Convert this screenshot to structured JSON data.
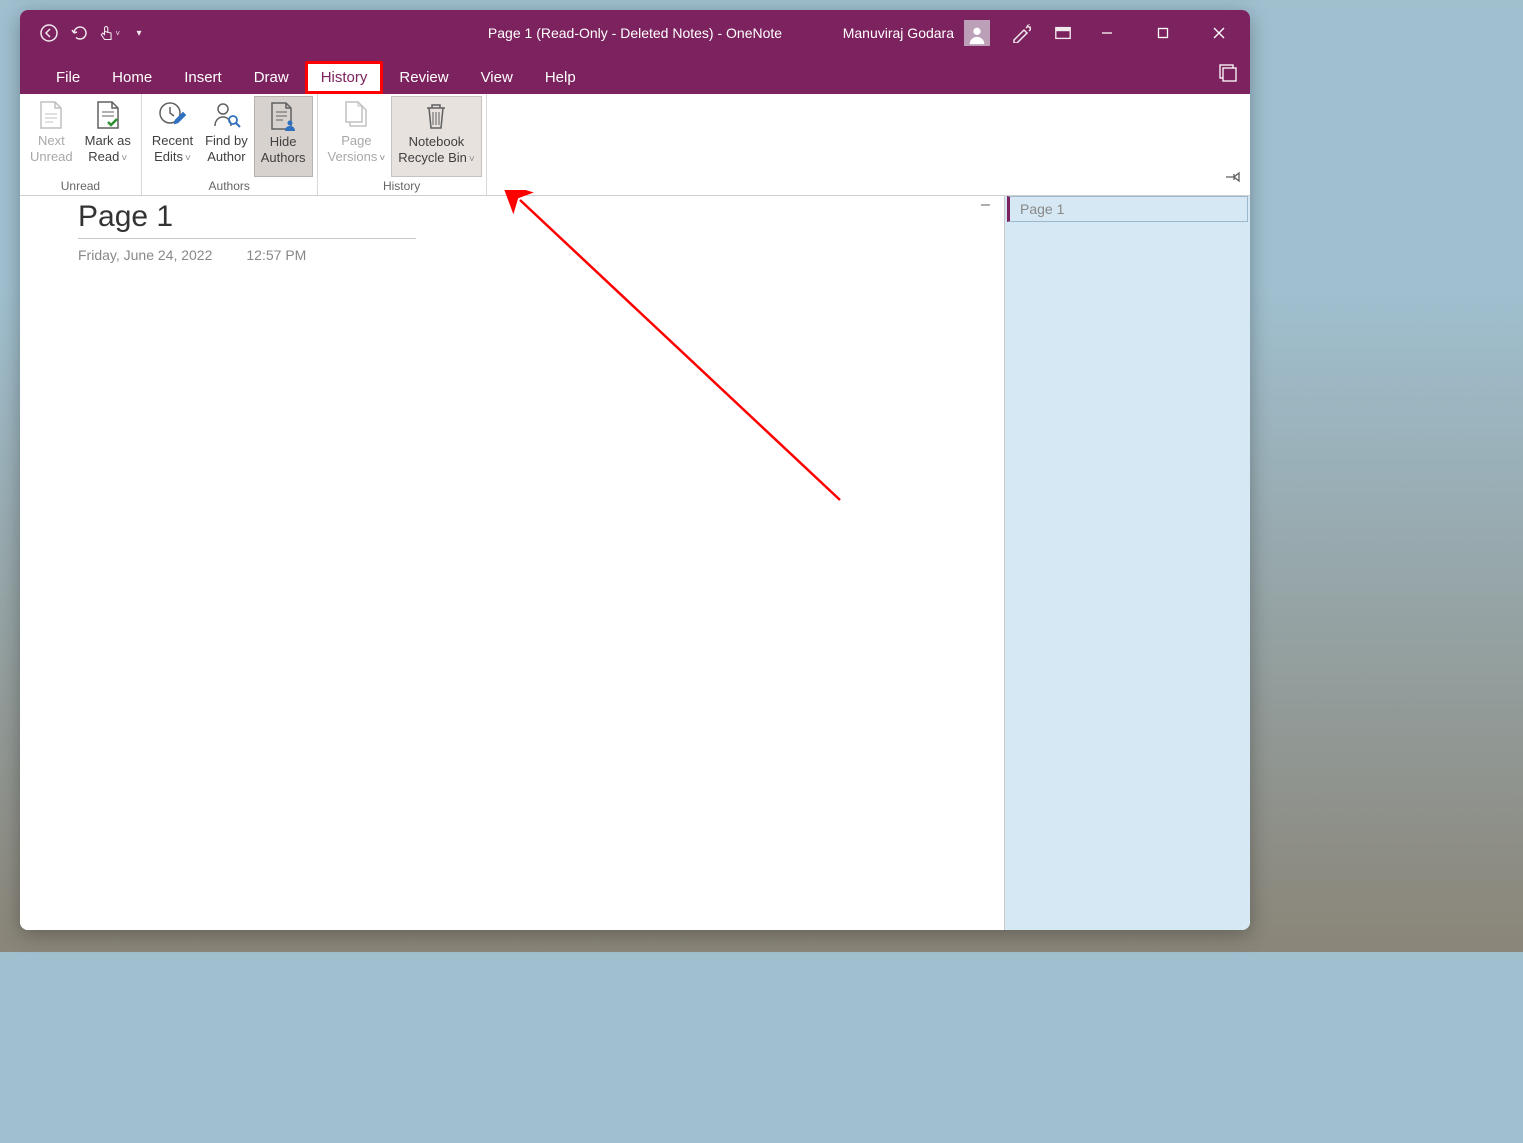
{
  "titlebar": {
    "title": "Page 1 (Read-Only - Deleted Notes)  -  OneNote",
    "user": "Manuviraj Godara"
  },
  "tabs": {
    "file": "File",
    "home": "Home",
    "insert": "Insert",
    "draw": "Draw",
    "history": "History",
    "review": "Review",
    "view": "View",
    "help": "Help"
  },
  "ribbon": {
    "groups": {
      "unread": "Unread",
      "authors": "Authors",
      "history": "History"
    },
    "buttons": {
      "next_unread_1": "Next",
      "next_unread_2": "Unread",
      "mark_read_1": "Mark as",
      "mark_read_2": "Read",
      "recent_edits_1": "Recent",
      "recent_edits_2": "Edits",
      "find_author_1": "Find by",
      "find_author_2": "Author",
      "hide_authors_1": "Hide",
      "hide_authors_2": "Authors",
      "page_versions_1": "Page",
      "page_versions_2": "Versions",
      "recycle_bin_1": "Notebook",
      "recycle_bin_2": "Recycle Bin"
    }
  },
  "page": {
    "title": "Page 1",
    "date": "Friday, June 24, 2022",
    "time": "12:57 PM"
  },
  "sidebar": {
    "page_item": "Page 1"
  }
}
